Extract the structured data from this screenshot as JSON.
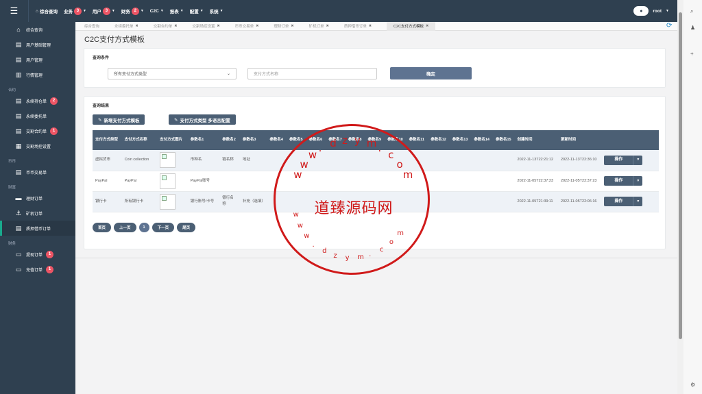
{
  "topnav": [
    {
      "label": "综合查询",
      "badge": "",
      "caret": false
    },
    {
      "label": "业务",
      "badge": "3",
      "caret": true
    },
    {
      "label": "用户",
      "badge": "3",
      "caret": true
    },
    {
      "label": "财务",
      "badge": "2",
      "caret": true
    },
    {
      "label": "C2C",
      "badge": "",
      "caret": true
    },
    {
      "label": "报表",
      "badge": "",
      "caret": true
    },
    {
      "label": "配置",
      "badge": "",
      "caret": true
    },
    {
      "label": "系统",
      "badge": "",
      "caret": true
    }
  ],
  "user": {
    "name": "root"
  },
  "sidebar": {
    "top": [
      {
        "label": "综合查询",
        "badge": ""
      },
      {
        "label": "用户基础管理",
        "badge": ""
      },
      {
        "label": "用户管理",
        "badge": ""
      },
      {
        "label": "行情管理",
        "badge": ""
      }
    ],
    "sec1": "合约",
    "contract": [
      {
        "label": "永续持仓单",
        "badge": "2"
      },
      {
        "label": "永续委托单",
        "badge": ""
      },
      {
        "label": "交割合约单",
        "badge": "1"
      },
      {
        "label": "交割场控设置",
        "badge": ""
      }
    ],
    "sec2": "币币",
    "coin": [
      {
        "label": "币币交易单",
        "badge": ""
      }
    ],
    "sec3": "财富",
    "wealth": [
      {
        "label": "理财订单",
        "badge": ""
      },
      {
        "label": "矿机订单",
        "badge": ""
      },
      {
        "label": "质押借币订单",
        "badge": ""
      }
    ],
    "sec4": "财务",
    "finance": [
      {
        "label": "提现订单",
        "badge": "1"
      },
      {
        "label": "充值订单",
        "badge": "1"
      }
    ]
  },
  "tabs": [
    "综合查询",
    "永续委托单",
    "交割合约单",
    "交割场控设置",
    "币币交易单",
    "理财订单",
    "矿机订单",
    "质押借币订单",
    "C2C支付方式模板"
  ],
  "page": {
    "title": "C2C支付方式模板"
  },
  "query": {
    "title": "查询条件",
    "type_select": "所有支付方式类型",
    "name_placeholder": "支付方式名称",
    "ok_label": "确定"
  },
  "result": {
    "title": "查询结果",
    "add_label": "新增支付方式模板",
    "lang_label": "支付方式类型 多语言配置",
    "headers": [
      "支付方式类型",
      "支付方式名称",
      "支付方式图片",
      "参数名1",
      "参数名2",
      "参数名3",
      "参数名4",
      "参数名5",
      "参数名6",
      "参数名7",
      "参数名8",
      "参数名9",
      "参数名10",
      "参数名11",
      "参数名12",
      "参数名13",
      "参数名14",
      "参数名15",
      "创建时间",
      "更新时间",
      ""
    ],
    "rows": [
      [
        "虚拟货币",
        "Coin collection",
        "",
        "币种名",
        "链名称",
        "地址",
        "",
        "",
        "",
        "",
        "",
        "",
        "",
        "",
        "",
        "",
        "",
        "",
        "2022-11-13T22:21:12",
        "2022-11-13T22:36:10"
      ],
      [
        "PayPal",
        "PayPal",
        "",
        "PayPal账号",
        "",
        "",
        "",
        "",
        "",
        "",
        "",
        "",
        "",
        "",
        "",
        "",
        "",
        "",
        "2022-11-05T22:37:23",
        "2022-11-05T22:37:23"
      ],
      [
        "银行卡",
        "所有银行卡",
        "",
        "银行账号/卡号",
        "银行名称",
        "补充（选填）",
        "",
        "",
        "",
        "",
        "",
        "",
        "",
        "",
        "",
        "",
        "",
        "",
        "2022-11-05T21:39:11",
        "2022-11-05T22:06:16"
      ]
    ],
    "op_label": "操作"
  },
  "pager": {
    "first": "首页",
    "prev": "上一页",
    "current": "1",
    "next": "下一页",
    "last": "尾页"
  },
  "watermark": {
    "text": "道臻源码网",
    "url": "www.dzym.com"
  }
}
